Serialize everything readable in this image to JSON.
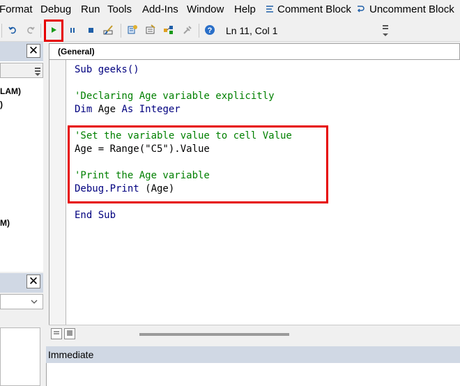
{
  "menu": [
    {
      "label": "Format",
      "underline": "o"
    },
    {
      "label": "Debug",
      "underline": "D"
    },
    {
      "label": "Run",
      "underline": "R"
    },
    {
      "label": "Tools",
      "underline": "T"
    },
    {
      "label": "Add-Ins",
      "underline": "A"
    },
    {
      "label": "Window",
      "underline": "W"
    },
    {
      "label": "Help",
      "underline": "H"
    }
  ],
  "menu_labels": {
    "format": "Format",
    "debug": "Debug",
    "run": "Run",
    "tools": "Tools",
    "addins": "Add-Ins",
    "window": "Window",
    "help": "Help",
    "comment_block": "Comment Block",
    "uncomment_block": "Uncomment Block"
  },
  "toolbar": {
    "icons": [
      "undo-icon",
      "redo-icon",
      "run-icon",
      "break-icon",
      "reset-icon",
      "design-mode-icon",
      "project-explorer-icon",
      "properties-icon",
      "object-browser-icon",
      "toolbox-icon",
      "help-icon"
    ],
    "location": "Ln 11, Col 1"
  },
  "left_panel": {
    "text1": "LAM)",
    "text2": ")",
    "text3": "M)"
  },
  "code_window": {
    "object_dropdown": "(General)",
    "lines": [
      {
        "text": "Sub geeks()",
        "kind": "keyword"
      },
      {
        "text": "",
        "kind": "text"
      },
      {
        "text": "'Declaring Age variable explicitly",
        "kind": "comment"
      },
      {
        "text": "Dim Age As Integer",
        "kind": "keyword"
      },
      {
        "text": "",
        "kind": "text"
      },
      {
        "text": "'Set the variable value to cell Value",
        "kind": "comment"
      },
      {
        "text": "Age = Range(\"C5\").Value",
        "kind": "text"
      },
      {
        "text": "",
        "kind": "text"
      },
      {
        "text": "'Print the Age variable",
        "kind": "comment"
      },
      {
        "text": "Debug.Print (Age)",
        "kind": "mixed"
      },
      {
        "text": "",
        "kind": "text"
      },
      {
        "text": "End Sub",
        "kind": "keyword"
      }
    ]
  },
  "immediate": {
    "title": "Immediate"
  },
  "colors": {
    "keyword": "#00007f",
    "comment": "#008000",
    "highlight": "#e60000",
    "title_bar": "#d0d8e4"
  }
}
